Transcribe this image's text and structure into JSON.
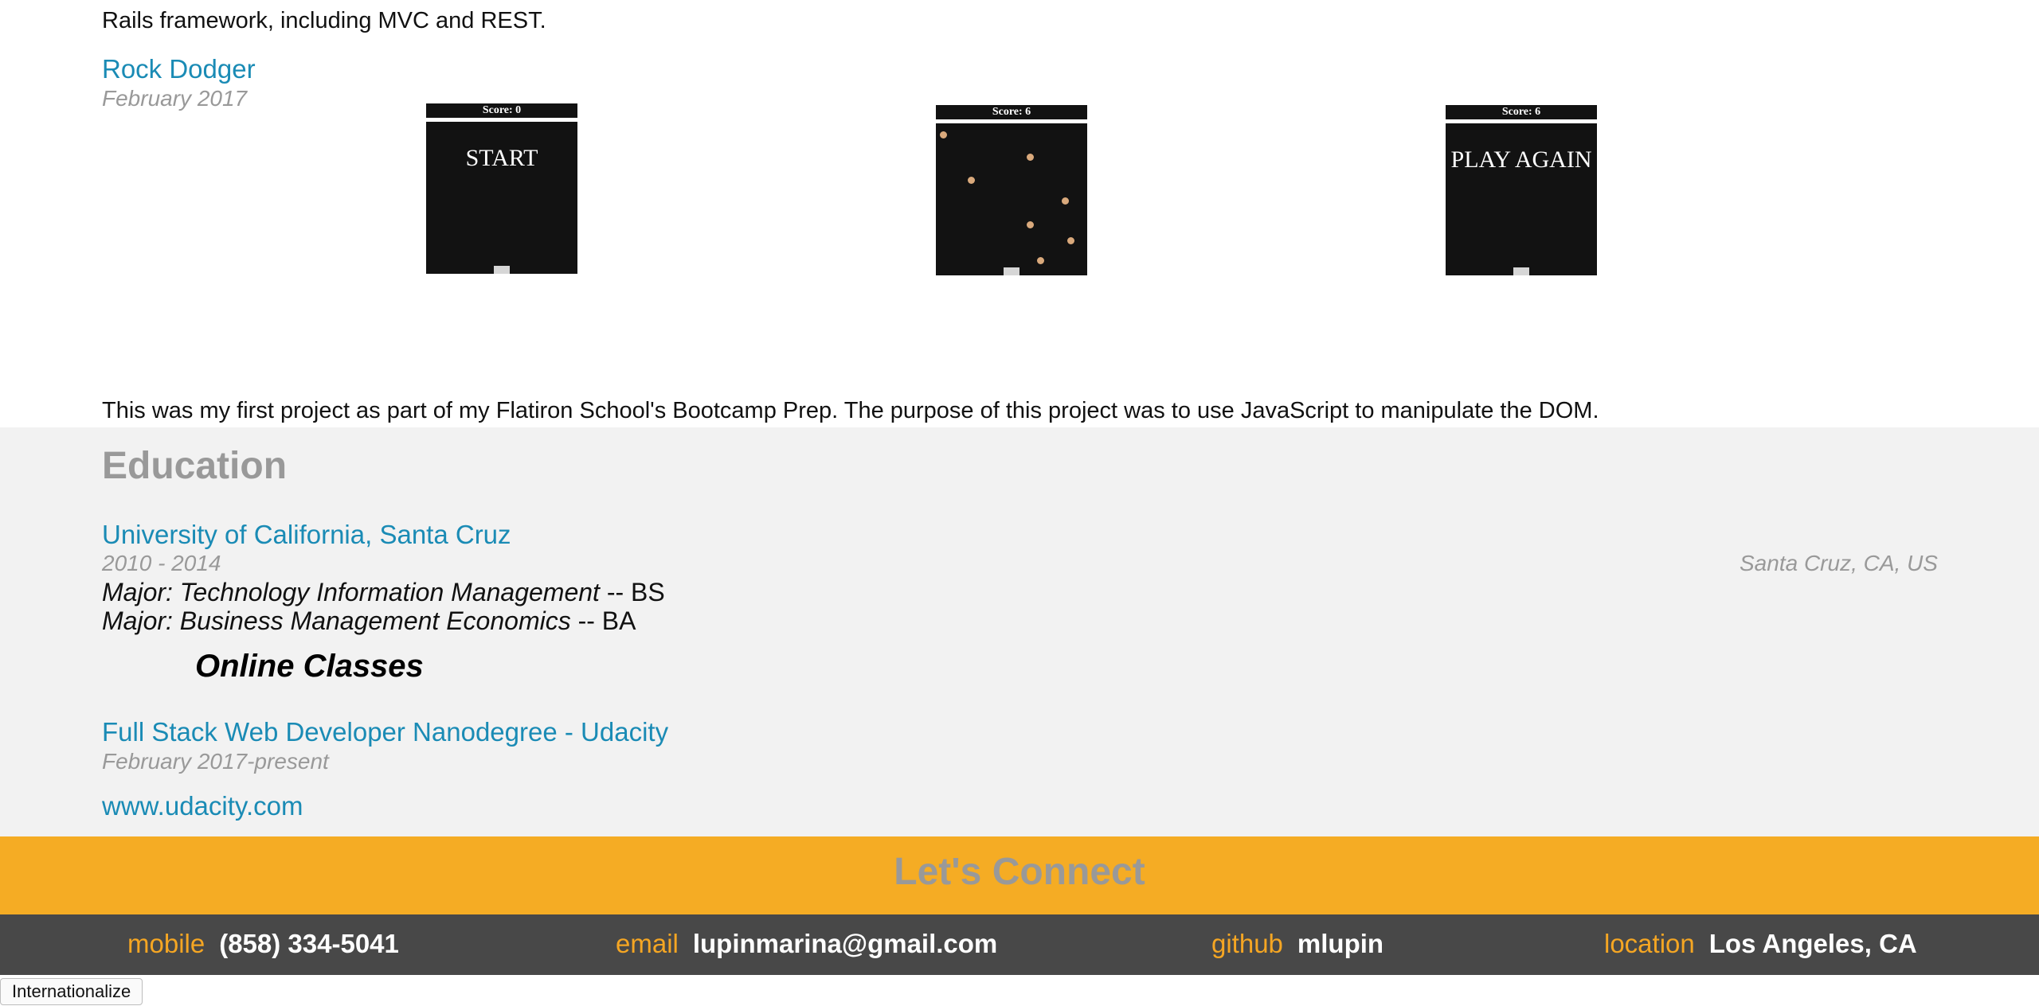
{
  "project_prev": {
    "description_tail": "Rails framework, including MVC and REST."
  },
  "project": {
    "title": "Rock Dodger",
    "date": "February 2017",
    "screens": [
      {
        "score": "Score: 0",
        "message": "START"
      },
      {
        "score": "Score: 6",
        "message": ""
      },
      {
        "score": "Score: 6",
        "message": "PLAY AGAIN"
      }
    ],
    "description": "This was my first project as part of my Flatiron School's Bootcamp Prep. The purpose of this project was to use JavaScript to manipulate the DOM."
  },
  "education": {
    "heading": "Education",
    "school": {
      "name": "University of California, Santa Cruz",
      "dates": "2010 - 2014",
      "location": "Santa Cruz, CA, US",
      "majors": [
        {
          "name": "Major: Technology Information Management",
          "degree": " -- BS"
        },
        {
          "name": "Major: Business Management Economics",
          "degree": " -- BA"
        }
      ]
    },
    "online": {
      "heading": "Online Classes",
      "title": "Full Stack Web Developer Nanodegree - Udacity",
      "dates": "February 2017-present",
      "url": "www.udacity.com"
    }
  },
  "connect": {
    "title": "Let's Connect",
    "mobile_label": "mobile",
    "mobile_value": "(858) 334-5041",
    "email_label": "email",
    "email_value": "lupinmarina@gmail.com",
    "github_label": "github",
    "github_value": "mlupin",
    "location_label": "location",
    "location_value": "Los Angeles, CA"
  },
  "buttons": {
    "internationalize": "Internationalize"
  },
  "colors": {
    "link": "#1a8bb5",
    "muted": "#999999",
    "accent": "#f5ac24",
    "footer": "#484848"
  }
}
